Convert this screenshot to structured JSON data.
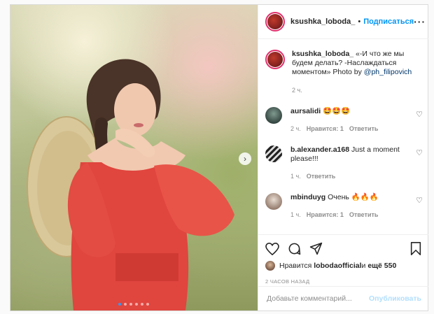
{
  "post": {
    "username": "ksushka_loboda_",
    "separator": "•",
    "follow_label": "Подписаться",
    "more_label": "···",
    "caption_user": "ksushka_loboda_",
    "caption_text": " «-И что же мы будем делать? -Наслаждаться моментом» Photo by ",
    "caption_mention": "@ph_filipovich",
    "caption_time": "2 ч."
  },
  "comments": [
    {
      "user": "aursalidi",
      "text": " 🤩🤩🤩",
      "time": "2 ч.",
      "likes": "Нравится: 1",
      "reply": "Ответить"
    },
    {
      "user": "b.alexander.a168",
      "text": " Just a moment please!!!",
      "time": "1 ч.",
      "reply": "Ответить"
    },
    {
      "user": "mbinduyg",
      "text": " Очень 🔥🔥🔥",
      "time": "1 ч.",
      "likes": "Нравится: 1",
      "reply": "Ответить"
    }
  ],
  "actions": {
    "likes_prefix": "Нравится ",
    "likes_user": "lobodaofficial",
    "likes_middle": " и ",
    "likes_count": "ещё 550",
    "posted": "2 ЧАСОВ НАЗАД"
  },
  "composer": {
    "placeholder": "Добавьте комментарий...",
    "publish_label": "Опубликовать"
  },
  "icons": {
    "more": "more-icon",
    "next": "chevron-right-icon",
    "like": "heart-icon",
    "comment": "comment-icon",
    "share": "send-icon",
    "save": "bookmark-icon"
  },
  "carousel": {
    "slides": 6,
    "active": 1
  },
  "colors": {
    "accent": "#0095f6",
    "story_ring": "#e1306c",
    "dot_active": "#3897f0"
  }
}
